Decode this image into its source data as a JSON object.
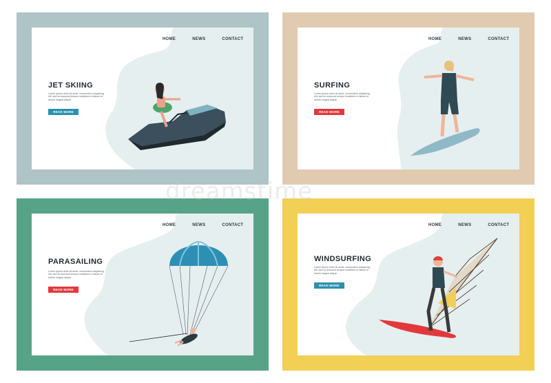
{
  "colors": {
    "panel_jet": "#aec4c7",
    "panel_surf": "#e0cbb0",
    "panel_para": "#56a388",
    "panel_wind": "#f2cf55",
    "blob": "#e6eff0",
    "btn_blue": "#2c8fae",
    "btn_red": "#e2383c"
  },
  "panels": [
    {
      "nav": [
        "HOME",
        "NEWS",
        "CONTACT"
      ],
      "title": "JET SKIING",
      "body": "Lorem ipsum dolor sit amet, consectetur adipiscing elit, sed do eiusmod tempor incididunt ut labore et dolore magna aliqua.",
      "button": "READ MORE"
    },
    {
      "nav": [
        "HOME",
        "NEWS",
        "CONTACT"
      ],
      "title": "SURFING",
      "body": "Lorem ipsum dolor sit amet, consectetur adipiscing elit, sed do eiusmod tempor incididunt ut labore et dolore magna aliqua.",
      "button": "READ MORE"
    },
    {
      "nav": [
        "HOME",
        "NEWS",
        "CONTACT"
      ],
      "title": "PARASAILING",
      "body": "Lorem ipsum dolor sit amet, consectetur adipiscing elit, sed do eiusmod tempor incididunt ut labore et dolore magna aliqua.",
      "button": "READ MORE"
    },
    {
      "nav": [
        "HOME",
        "NEWS",
        "CONTACT"
      ],
      "title": "WINDSURFING",
      "body": "Lorem ipsum dolor sit amet, consectetur adipiscing elit, sed do eiusmod tempor incididunt ut labore et dolore magna aliqua.",
      "button": "READ MORE"
    }
  ],
  "watermark": "dreamstime"
}
